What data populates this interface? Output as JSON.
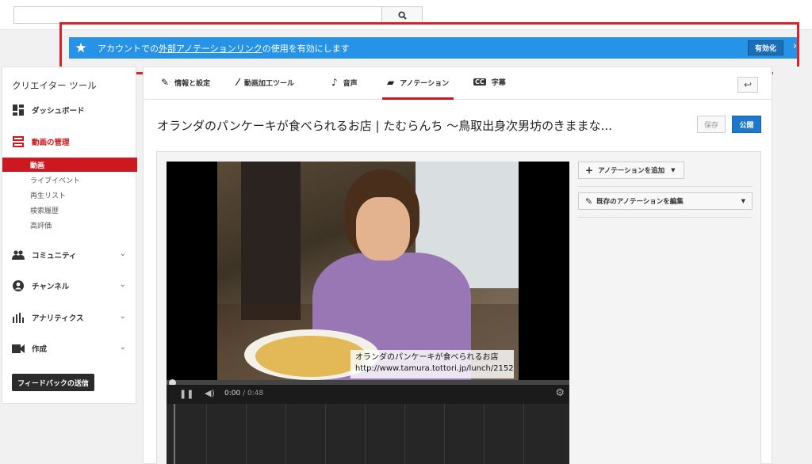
{
  "search": {
    "placeholder": "",
    "button_icon": "search-icon"
  },
  "banner": {
    "text_before": "アカウントでの",
    "link_text": "外部アノテーションリンク",
    "text_after": "の使用を有効にします",
    "enable_label": "有効化",
    "arrow": "›",
    "star": "★",
    "color": "#2793e6",
    "highlight_color": "#d8232a"
  },
  "sidebar": {
    "title": "クリエイター ツール",
    "dashboard": "ダッシュボード",
    "video_manager": "動画の管理",
    "sub_items": [
      "動画",
      "ライブイベント",
      "再生リスト",
      "検索履歴",
      "高評価"
    ],
    "community": "コミュニティ",
    "channel": "チャンネル",
    "analytics": "アナリティクス",
    "create": "作成",
    "feedback_label": "フィードバックの送信",
    "accent_color": "#cc181e"
  },
  "tabs": {
    "info": "情報と設定",
    "enhancements": "動画加工ツール",
    "audio": "音声",
    "annotations": "アノテーション",
    "subtitles": "字幕",
    "active": "annotations"
  },
  "video": {
    "title": "オランダのパンケーキが食べられるお店 | たむらんち ～鳥取出身次男坊のきままな...",
    "save_label": "保存",
    "publish_label": "公開",
    "annotation_line1": "オランダのパンケーキが食べられるお店",
    "annotation_line2": "http://www.tamura.tottori.jp/lunch/2152",
    "time_current": "0:00",
    "time_separator": " / ",
    "time_total": "0:48",
    "progress": 0.0
  },
  "annotation_panel": {
    "add_label": "アノテーションを追加",
    "edit_label": "既存のアノテーションを編集"
  }
}
